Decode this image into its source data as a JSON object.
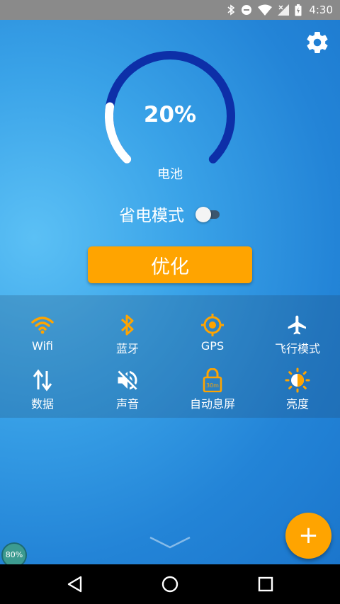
{
  "status_bar": {
    "time": "4:30",
    "icons": [
      "bluetooth-icon",
      "do-not-disturb-icon",
      "wifi-icon",
      "no-signal-icon",
      "battery-charging-icon"
    ]
  },
  "battery": {
    "percent_text": "20%",
    "level": 0.2,
    "label": "电池"
  },
  "power_saving": {
    "label": "省电模式",
    "enabled": false
  },
  "optimize_button": {
    "label": "优化"
  },
  "quick_settings": [
    {
      "label": "Wifi",
      "icon": "wifi-icon"
    },
    {
      "label": "蓝牙",
      "icon": "bluetooth-icon"
    },
    {
      "label": "GPS",
      "icon": "gps-icon"
    },
    {
      "label": "飞行模式",
      "icon": "airplane-icon"
    },
    {
      "label": "数据",
      "icon": "data-arrows-icon"
    },
    {
      "label": "声音",
      "icon": "sound-off-icon"
    },
    {
      "label": "自动息屏",
      "icon": "screen-timeout-icon",
      "badge": "30m"
    },
    {
      "label": "亮度",
      "icon": "brightness-icon"
    }
  ],
  "fab": {
    "label": "+"
  },
  "floating_badge": {
    "label": "80%"
  },
  "colors": {
    "accent": "#ffa400",
    "gauge_track": "#0d2fa8",
    "gauge_fill": "#ffffff"
  }
}
